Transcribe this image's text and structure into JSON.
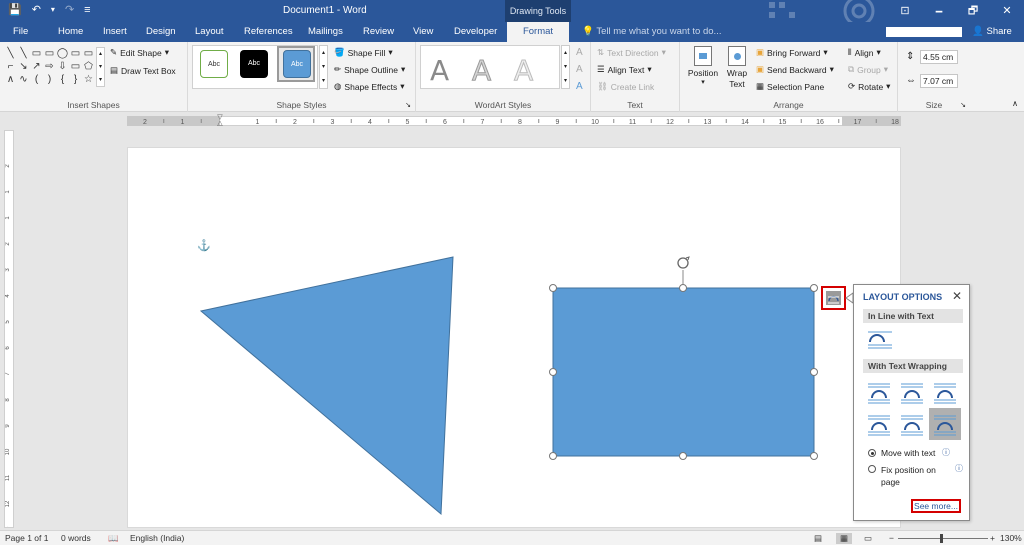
{
  "window": {
    "doc_title": "Document1 - Word",
    "context_group": "Drawing Tools",
    "minimize_glyph": "🗕",
    "restore_glyph": "🗗",
    "close_glyph": "✕",
    "ribbon_display_glyph": "⊡"
  },
  "qat": {
    "save": "💾",
    "undo": "↶",
    "undo_arrow": "▾",
    "redo": "↷",
    "customize": "≡"
  },
  "tabs": {
    "file": "File",
    "home": "Home",
    "insert": "Insert",
    "design": "Design",
    "layout": "Layout",
    "references": "References",
    "mailings": "Mailings",
    "review": "Review",
    "view": "View",
    "developer": "Developer",
    "format": "Format"
  },
  "tell_me": "Tell me what you want to do...",
  "share": "Share",
  "ribbon": {
    "insert_shapes": {
      "label": "Insert Shapes",
      "edit_shape": "Edit Shape",
      "draw_text_box": "Draw Text Box",
      "shape_glyphs": [
        "╲",
        "╲",
        "▭",
        "▭",
        "◯",
        "▭",
        "▭",
        "⌐",
        "↘",
        "↗",
        "⇨",
        "⇩",
        "▭",
        "⬠",
        "∧",
        "∿",
        "(",
        ")",
        "{",
        "}",
        "☆"
      ]
    },
    "shape_styles": {
      "label": "Shape Styles",
      "style1": "Abc",
      "style2": "Abc",
      "style3": "Abc",
      "shape_fill": "Shape Fill",
      "shape_outline": "Shape Outline",
      "shape_effects": "Shape Effects"
    },
    "wordart": {
      "label": "WordArt Styles",
      "letter": "A"
    },
    "text": {
      "label": "Text",
      "text_direction": "Text Direction",
      "align_text": "Align Text",
      "create_link": "Create Link"
    },
    "arrange": {
      "label": "Arrange",
      "position": "Position",
      "wrap_text": "Wrap Text",
      "bring_forward": "Bring Forward",
      "send_backward": "Send Backward",
      "selection_pane": "Selection Pane",
      "align": "Align",
      "group": "Group",
      "rotate": "Rotate"
    },
    "size": {
      "label": "Size",
      "height": "4.55 cm",
      "width": "7.07 cm"
    }
  },
  "ruler": {
    "h_labels": [
      "2",
      "1",
      "1",
      "2",
      "3",
      "4",
      "5",
      "6",
      "7",
      "8",
      "9",
      "10",
      "11",
      "12",
      "13",
      "14",
      "15",
      "16",
      "17",
      "18"
    ],
    "v_labels": [
      "2",
      "1",
      "1",
      "2",
      "3",
      "4",
      "5",
      "6",
      "7",
      "8",
      "9",
      "10",
      "11",
      "12",
      "13"
    ]
  },
  "layout_options": {
    "title": "LAYOUT OPTIONS",
    "close": "✕",
    "inline_section": "In Line with Text",
    "wrapping_section": "With Text Wrapping",
    "move_with_text": "Move with text",
    "fix_position": "Fix position on page",
    "info_glyph": "ⓘ",
    "see_more": "See more..."
  },
  "statusbar": {
    "page": "Page 1 of 1",
    "words": "0 words",
    "language": "English (India)",
    "zoom": "130%",
    "zoom_minus": "−",
    "zoom_plus": "+"
  },
  "colors": {
    "brand": "#2b579a",
    "shape_fill": "#5b9bd5",
    "shape_stroke": "#41719c",
    "highlight": "#d40000"
  }
}
